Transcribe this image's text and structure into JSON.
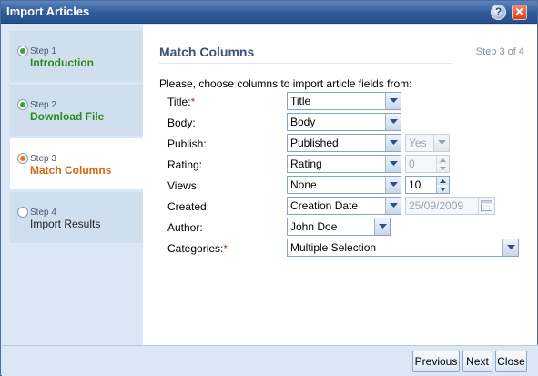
{
  "window": {
    "title": "Import Articles",
    "help_icon": "?",
    "close_icon": "✕"
  },
  "steps": [
    {
      "small": "Step 1",
      "label": "Introduction",
      "state": "done"
    },
    {
      "small": "Step 2",
      "label": "Download File",
      "state": "done"
    },
    {
      "small": "Step 3",
      "label": "Match Columns",
      "state": "current"
    },
    {
      "small": "Step 4",
      "label": "Import Results",
      "state": "pending"
    }
  ],
  "main": {
    "heading": "Match Columns",
    "step_counter": "Step 3 of 4",
    "intro": "Please, choose columns to import article fields from:"
  },
  "fields": {
    "title": {
      "label": "Title:",
      "required": "*",
      "value": "Title"
    },
    "body": {
      "label": "Body:",
      "value": "Body"
    },
    "publish": {
      "label": "Publish:",
      "value": "Published",
      "default_value": "Yes"
    },
    "rating": {
      "label": "Rating:",
      "value": "Rating",
      "default_value": "0"
    },
    "views": {
      "label": "Views:",
      "value": "None",
      "default_value": "10"
    },
    "created": {
      "label": "Created:",
      "value": "Creation Date",
      "default_value": "25/09/2009"
    },
    "author": {
      "label": "Author:",
      "value": "John Doe"
    },
    "categories": {
      "label": "Categories:",
      "required": "*",
      "value": "Multiple Selection"
    }
  },
  "buttons": {
    "previous": "Previous",
    "next": "Next",
    "close": "Close"
  },
  "colors": {
    "done": "#2b8b1d",
    "current": "#d0690f",
    "required": "#d1281f",
    "titlebar": "#2f5a98"
  }
}
